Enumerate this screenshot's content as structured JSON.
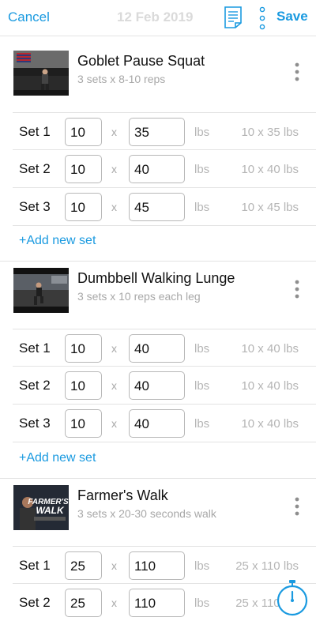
{
  "header": {
    "cancel_label": "Cancel",
    "date": "12 Feb 2019",
    "save_label": "Save",
    "notes_icon": "notes-icon",
    "more_icon": "more-vertical-icon"
  },
  "exercises": [
    {
      "name": "Goblet Pause Squat",
      "subtitle": "3 sets x 8-10 reps",
      "thumb_icon": "exercise-thumbnail",
      "sets": [
        {
          "label": "Set 1",
          "reps": "10",
          "x": "x",
          "weight": "35",
          "unit": "lbs",
          "summary": "10 x 35 lbs"
        },
        {
          "label": "Set 2",
          "reps": "10",
          "x": "x",
          "weight": "40",
          "unit": "lbs",
          "summary": "10 x 40 lbs"
        },
        {
          "label": "Set 3",
          "reps": "10",
          "x": "x",
          "weight": "45",
          "unit": "lbs",
          "summary": "10 x 45 lbs"
        }
      ],
      "add_set_label": "+Add new set"
    },
    {
      "name": "Dumbbell Walking Lunge",
      "subtitle": "3 sets x 10 reps each leg",
      "thumb_icon": "exercise-thumbnail",
      "sets": [
        {
          "label": "Set 1",
          "reps": "10",
          "x": "x",
          "weight": "40",
          "unit": "lbs",
          "summary": "10 x 40 lbs"
        },
        {
          "label": "Set 2",
          "reps": "10",
          "x": "x",
          "weight": "40",
          "unit": "lbs",
          "summary": "10 x 40 lbs"
        },
        {
          "label": "Set 3",
          "reps": "10",
          "x": "x",
          "weight": "40",
          "unit": "lbs",
          "summary": "10 x 40 lbs"
        }
      ],
      "add_set_label": "+Add new set"
    },
    {
      "name": "Farmer's Walk",
      "subtitle": "3 sets x 20-30 seconds walk",
      "thumb_icon": "exercise-thumbnail",
      "thumb_text": "FARMER'S WALK",
      "sets": [
        {
          "label": "Set 1",
          "reps": "25",
          "x": "x",
          "weight": "110",
          "unit": "lbs",
          "summary": "25 x 110 lbs"
        },
        {
          "label": "Set 2",
          "reps": "25",
          "x": "x",
          "weight": "110",
          "unit": "lbs",
          "summary": "25 x 110 lbs"
        }
      ]
    }
  ],
  "timer_icon": "stopwatch-icon",
  "colors": {
    "accent": "#1a9ae0",
    "muted_text": "#a8a8a8",
    "border": "#b8b8b8"
  }
}
